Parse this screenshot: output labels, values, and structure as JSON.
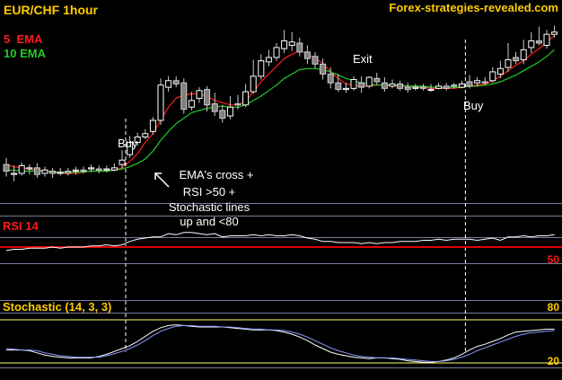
{
  "chart_data": [
    {
      "type": "candlestick",
      "title": "EUR/CHF 1hour",
      "watermark": "Forex-strategies-revealed.com",
      "legend": [
        {
          "label": "5  EMA",
          "color": "#ff1a1a"
        },
        {
          "label": "10 EMA",
          "color": "#22cc22"
        }
      ],
      "candle_colors": {
        "up": "#ffffff",
        "down": "#808080"
      },
      "annotations": {
        "buy1": "Buy",
        "buy2": "Buy",
        "exit": "Exit",
        "note": [
          "EMA's cross +",
          "RSI >50 +",
          "Stochastic lines",
          "up and <80"
        ]
      },
      "candles": [
        [
          30,
          24,
          36,
          19
        ],
        [
          21,
          22,
          29,
          15
        ],
        [
          22,
          29,
          32,
          20
        ],
        [
          26,
          27,
          30,
          21
        ],
        [
          27,
          21,
          31,
          18
        ],
        [
          22,
          25,
          28,
          19
        ],
        [
          24,
          22,
          27,
          18
        ],
        [
          22,
          23,
          27,
          20
        ],
        [
          24,
          22,
          27,
          20
        ],
        [
          24,
          25,
          28,
          21
        ],
        [
          25,
          24,
          28,
          22
        ],
        [
          26,
          27,
          30,
          23
        ],
        [
          26,
          25,
          29,
          22
        ],
        [
          25,
          26,
          29,
          23
        ],
        [
          25,
          27,
          31,
          24
        ],
        [
          30,
          34,
          43,
          27
        ],
        [
          39,
          50,
          56,
          36
        ],
        [
          50,
          55,
          59,
          47
        ],
        [
          55,
          58,
          62,
          53
        ],
        [
          60,
          70,
          73,
          57
        ],
        [
          70,
          102,
          108,
          66
        ],
        [
          100,
          106,
          110,
          96
        ],
        [
          106,
          103,
          110,
          100
        ],
        [
          104,
          80,
          108,
          76
        ],
        [
          82,
          88,
          96,
          79
        ],
        [
          90,
          97,
          100,
          86
        ],
        [
          98,
          84,
          101,
          78
        ],
        [
          85,
          78,
          95,
          74
        ],
        [
          79,
          72,
          84,
          68
        ],
        [
          74,
          82,
          92,
          71
        ],
        [
          85,
          84,
          93,
          80
        ],
        [
          84,
          96,
          103,
          82
        ],
        [
          96,
          110,
          125,
          94
        ],
        [
          110,
          124,
          130,
          107
        ],
        [
          123,
          127,
          134,
          119
        ],
        [
          127,
          136,
          140,
          124
        ],
        [
          135,
          142,
          152,
          131
        ],
        [
          138,
          141,
          150,
          133
        ],
        [
          140,
          132,
          145,
          128
        ],
        [
          132,
          126,
          138,
          121
        ],
        [
          128,
          121,
          132,
          117
        ],
        [
          121,
          112,
          126,
          107
        ],
        [
          112,
          104,
          118,
          99
        ],
        [
          104,
          98,
          112,
          96
        ],
        [
          98,
          99,
          104,
          95
        ],
        [
          99,
          107,
          110,
          97
        ],
        [
          104,
          100,
          110,
          95
        ],
        [
          101,
          109,
          110,
          99
        ],
        [
          108,
          105,
          113,
          102
        ],
        [
          104,
          99,
          109,
          96
        ],
        [
          101,
          103,
          107,
          99
        ],
        [
          103,
          99,
          106,
          97
        ],
        [
          100,
          98,
          104,
          95
        ],
        [
          99,
          100,
          103,
          97
        ],
        [
          100,
          99,
          103,
          97
        ],
        [
          98,
          98,
          103,
          96
        ],
        [
          99,
          101,
          104,
          98
        ],
        [
          101,
          99,
          104,
          97
        ],
        [
          102,
          101,
          104,
          99
        ],
        [
          100,
          103,
          106,
          99
        ],
        [
          105,
          101,
          111,
          99
        ],
        [
          104,
          106,
          109,
          101
        ],
        [
          105,
          104,
          109,
          102
        ],
        [
          106,
          114,
          118,
          104
        ],
        [
          112,
          117,
          124,
          108
        ],
        [
          118,
          125,
          140,
          114
        ],
        [
          127,
          124,
          132,
          121
        ],
        [
          125,
          134,
          143,
          121
        ],
        [
          136,
          142,
          150,
          131
        ],
        [
          142,
          140,
          155,
          138
        ],
        [
          138,
          148,
          152,
          135
        ],
        [
          148,
          150,
          156,
          145
        ]
      ],
      "ema5": [
        30,
        28,
        27,
        26,
        25,
        24,
        23,
        22,
        22,
        22,
        23,
        24,
        24,
        24,
        25,
        27,
        33,
        40,
        50,
        58,
        70,
        82,
        90,
        93,
        94,
        94,
        92,
        88,
        86,
        84,
        84,
        87,
        96,
        105,
        112,
        119,
        126,
        130,
        133,
        130,
        126,
        122,
        114,
        108,
        103,
        102,
        101,
        101,
        102,
        102,
        101,
        101,
        101,
        100,
        100,
        99,
        99,
        99,
        99,
        100,
        101,
        102,
        103,
        106,
        110,
        115,
        120,
        124,
        130,
        135,
        141,
        147
      ],
      "ema10": [
        25,
        25,
        24,
        24,
        24,
        24,
        23,
        23,
        23,
        23,
        23,
        24,
        24,
        24,
        25,
        26,
        28,
        31,
        35,
        42,
        52,
        60,
        67,
        72,
        77,
        79,
        81,
        82,
        83,
        82,
        82,
        84,
        88,
        92,
        97,
        102,
        108,
        112,
        116,
        117,
        117,
        116,
        114,
        111,
        108,
        106,
        104,
        103,
        102,
        102,
        102,
        102,
        101,
        101,
        101,
        100,
        100,
        100,
        100,
        100,
        101,
        101,
        102,
        103,
        105,
        108,
        111,
        115,
        119,
        123,
        128,
        134
      ],
      "price_range": [
        0,
        175
      ],
      "buy_markers": [
        15,
        59
      ],
      "exit_index": 39
    },
    {
      "type": "line",
      "title": "RSI 14",
      "level": 50,
      "level_label": "50",
      "ylim": [
        30,
        70
      ],
      "values": [
        47,
        48,
        48,
        49,
        49,
        49,
        50,
        49,
        50,
        50,
        50,
        51,
        51,
        52,
        51,
        52,
        55,
        57,
        58,
        59,
        59,
        62,
        61,
        63,
        63,
        62,
        61,
        62,
        59,
        60,
        60,
        60,
        61,
        60,
        61,
        60,
        60,
        61,
        60,
        58,
        57,
        55,
        55,
        54,
        54,
        54,
        53,
        54,
        53,
        54,
        54,
        55,
        55,
        55,
        56,
        56,
        57,
        56,
        57,
        57,
        57,
        56,
        57,
        58,
        56,
        59,
        59,
        60,
        59,
        60,
        60,
        61
      ]
    },
    {
      "type": "line",
      "title": "Stochastic (14, 3, 3)",
      "levels": [
        80,
        20
      ],
      "level_labels": [
        "80",
        "20"
      ],
      "ylim": [
        0,
        100
      ],
      "series": [
        {
          "color": "#ffffff",
          "values": [
            38,
            38,
            38,
            37,
            34,
            31,
            29,
            28,
            27,
            27,
            27,
            27,
            29,
            32,
            36,
            40,
            44,
            50,
            57,
            64,
            69,
            72,
            73,
            72,
            71,
            70,
            70,
            70,
            70,
            69,
            68,
            67,
            66,
            66,
            66,
            65,
            63,
            60,
            56,
            51,
            45,
            40,
            35,
            32,
            30,
            28,
            27,
            26,
            27,
            27,
            26,
            25,
            23,
            22,
            21,
            21,
            22,
            24,
            27,
            32,
            38,
            43,
            46,
            50,
            54,
            59,
            63,
            64,
            65,
            66,
            67,
            67
          ]
        },
        {
          "color": "#8899ff",
          "values": [
            40,
            39,
            38,
            38,
            37,
            34,
            32,
            30,
            29,
            28,
            28,
            28,
            28,
            30,
            33,
            36,
            40,
            45,
            51,
            58,
            64,
            68,
            71,
            72,
            72,
            71,
            71,
            71,
            70,
            70,
            69,
            68,
            67,
            67,
            66,
            66,
            65,
            63,
            60,
            56,
            51,
            46,
            41,
            37,
            34,
            31,
            29,
            28,
            27,
            27,
            27,
            26,
            25,
            24,
            23,
            22,
            22,
            23,
            25,
            28,
            32,
            37,
            41,
            45,
            49,
            53,
            57,
            60,
            62,
            63,
            64,
            65
          ]
        }
      ]
    }
  ]
}
